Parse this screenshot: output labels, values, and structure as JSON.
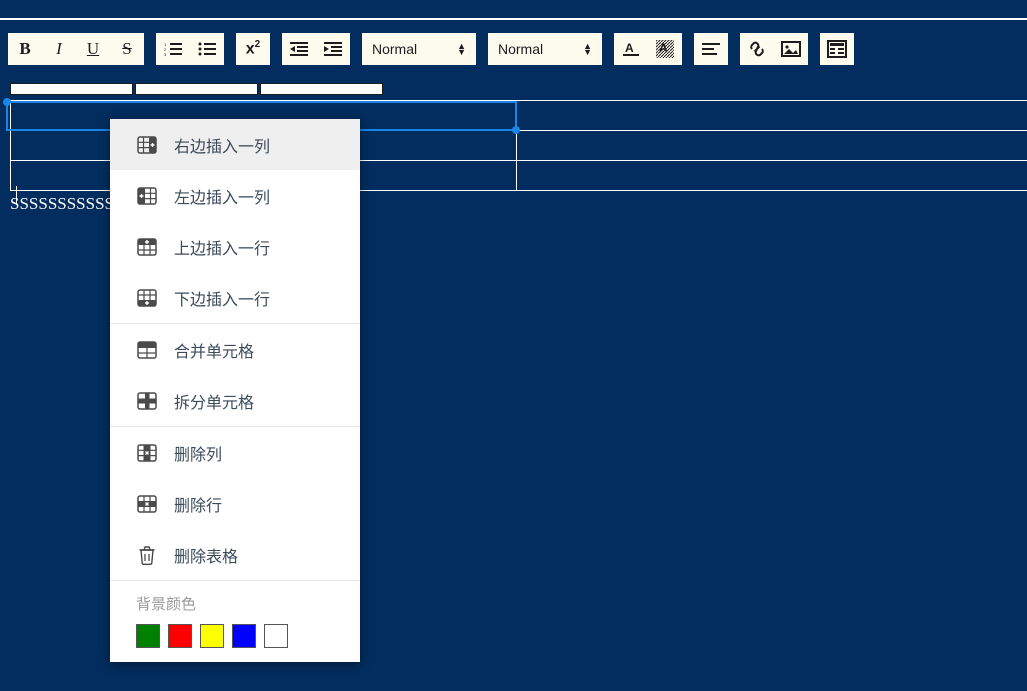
{
  "toolbar": {
    "groups": [
      {
        "name": "text-style",
        "buttons": [
          {
            "icon": "bold-icon",
            "label": "B"
          },
          {
            "icon": "italic-icon",
            "label": "I"
          },
          {
            "icon": "underline-icon",
            "label": "U"
          },
          {
            "icon": "strikethrough-icon",
            "label": "S"
          }
        ]
      },
      {
        "name": "lists",
        "buttons": [
          {
            "icon": "ordered-list-icon",
            "label": ""
          },
          {
            "icon": "bullet-list-icon",
            "label": ""
          }
        ]
      },
      {
        "name": "script",
        "buttons": [
          {
            "icon": "superscript-icon",
            "label": "x",
            "sup": "2"
          }
        ]
      },
      {
        "name": "indent",
        "buttons": [
          {
            "icon": "outdent-icon",
            "label": ""
          },
          {
            "icon": "indent-icon",
            "label": ""
          }
        ]
      }
    ],
    "selects": [
      {
        "name": "font-size-select",
        "value": "Normal"
      },
      {
        "name": "heading-select",
        "value": "Normal"
      }
    ],
    "color_group": [
      {
        "icon": "text-color-icon",
        "label": "A"
      },
      {
        "icon": "background-color-icon",
        "label": "A"
      }
    ],
    "align_group": [
      {
        "icon": "align-left-icon",
        "label": ""
      }
    ],
    "insert_group": [
      {
        "icon": "link-icon",
        "label": ""
      },
      {
        "icon": "image-icon",
        "label": ""
      }
    ],
    "table_group": [
      {
        "icon": "table-icon",
        "label": ""
      }
    ]
  },
  "editor": {
    "column_handles": [
      {
        "name": "column-handle-1"
      },
      {
        "name": "column-handle-2"
      },
      {
        "name": "column-handle-3"
      }
    ],
    "table": {
      "rows": [
        {
          "cells": [
            {
              "text": ""
            },
            {
              "text": ""
            }
          ]
        },
        {
          "cells": [
            {
              "text": ""
            },
            {
              "text": ""
            }
          ]
        },
        {
          "cells": [
            {
              "text": ""
            },
            {
              "text": ""
            }
          ]
        }
      ]
    },
    "body_text": "SSSSSSSSSSSSSSSS"
  },
  "context_menu": {
    "items": [
      {
        "label": "右边插入一列",
        "icon": "insert-column-right-icon",
        "name": "menu-insert-column-right",
        "highlighted": true
      },
      {
        "label": "左边插入一列",
        "icon": "insert-column-left-icon",
        "name": "menu-insert-column-left",
        "highlighted": false
      },
      {
        "label": "上边插入一行",
        "icon": "insert-row-above-icon",
        "name": "menu-insert-row-above",
        "highlighted": false
      },
      {
        "label": "下边插入一行",
        "icon": "insert-row-below-icon",
        "name": "menu-insert-row-below",
        "highlighted": false
      },
      {
        "label": "合并单元格",
        "icon": "merge-cells-icon",
        "name": "menu-merge-cells",
        "highlighted": false
      },
      {
        "label": "拆分单元格",
        "icon": "split-cells-icon",
        "name": "menu-split-cells",
        "highlighted": false
      },
      {
        "label": "删除列",
        "icon": "delete-column-icon",
        "name": "menu-delete-column",
        "highlighted": false
      },
      {
        "label": "删除行",
        "icon": "delete-row-icon",
        "name": "menu-delete-row",
        "highlighted": false
      },
      {
        "label": "删除表格",
        "icon": "trash-icon",
        "name": "menu-delete-table",
        "highlighted": false
      }
    ],
    "color_section": {
      "title": "背景颜色",
      "swatches": [
        {
          "name": "swatch-green",
          "color": "#008000"
        },
        {
          "name": "swatch-red",
          "color": "#ff0000"
        },
        {
          "name": "swatch-yellow",
          "color": "#ffff00"
        },
        {
          "name": "swatch-blue",
          "color": "#0000ff"
        },
        {
          "name": "swatch-white",
          "color": "#ffffff"
        }
      ]
    }
  },
  "theme": {
    "background": "#032d5e",
    "toolbar_button_bg": "#fdfbee",
    "selection_blue": "#1a84e8",
    "menu_bg": "#ffffff",
    "menu_hover": "#efefef",
    "menu_text": "#3c4a5a"
  }
}
